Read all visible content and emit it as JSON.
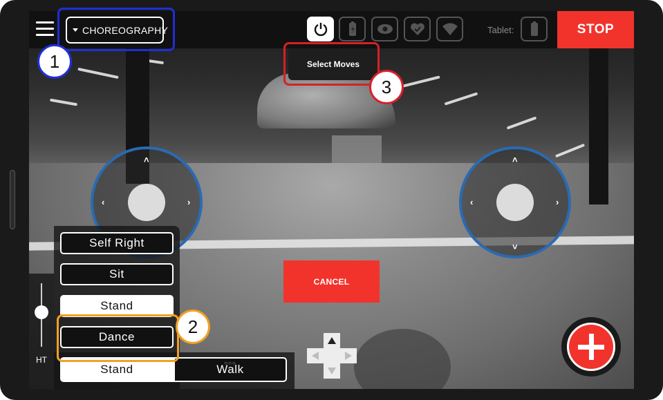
{
  "topbar": {
    "mode_label": "CHOREOGRAPHY",
    "select_moves": "Select Moves",
    "tablet_label": "Tablet:",
    "stop_label": "STOP",
    "status_icons": [
      "power-icon",
      "battery-icon",
      "eye-icon",
      "heart-icon",
      "wifi-icon"
    ]
  },
  "moves": {
    "self_right": "Self Right",
    "sit": "Sit",
    "stand": "Stand",
    "dance": "Dance"
  },
  "gait": {
    "stand": "Stand",
    "walk": "Walk",
    "dots": "○○○"
  },
  "height_control": {
    "label": "HT"
  },
  "cancel_label": "CANCEL",
  "annotations": {
    "one": "1",
    "two": "2",
    "three": "3"
  },
  "colors": {
    "stop_red": "#f2332c",
    "joystick_blue": "#2a6ab3",
    "annotation_blue": "#1f2fd6",
    "annotation_orange": "#f2a024",
    "annotation_red": "#d6202a"
  }
}
